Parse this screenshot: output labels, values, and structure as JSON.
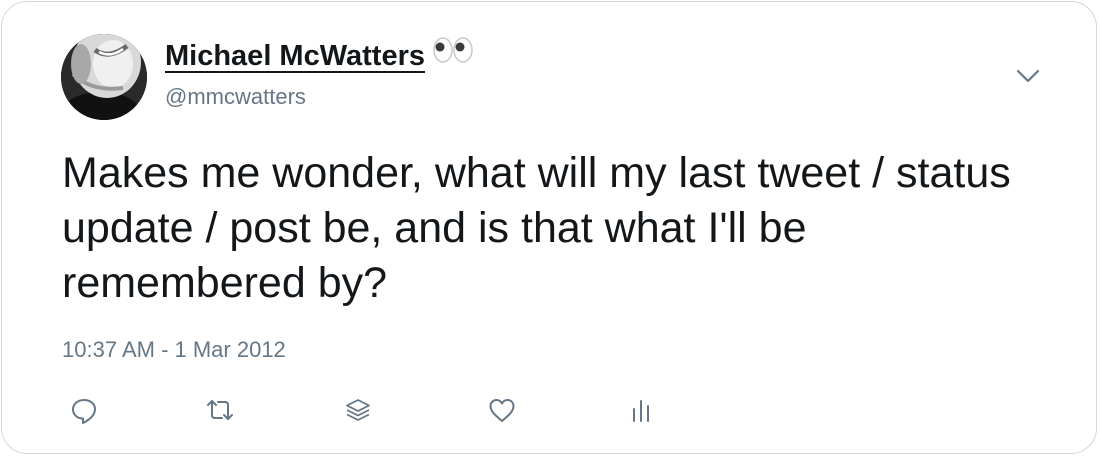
{
  "tweet": {
    "author": {
      "display_name": "Michael McWatters",
      "name_emoji": "eyes",
      "handle": "@mmcwatters",
      "avatar": "profile-photo"
    },
    "text": "Makes me wonder, what will my last tweet / status update / post be, and is that what I'll be remembered by?",
    "timestamp": "10:37 AM - 1 Mar 2012",
    "actions": [
      "reply-icon",
      "retweet-icon",
      "share-icon",
      "like-icon",
      "analytics-icon"
    ],
    "menu": "chevron-down-icon"
  },
  "colors": {
    "text": "#14171a",
    "secondary": "#657786",
    "border": "#cfd9de"
  }
}
